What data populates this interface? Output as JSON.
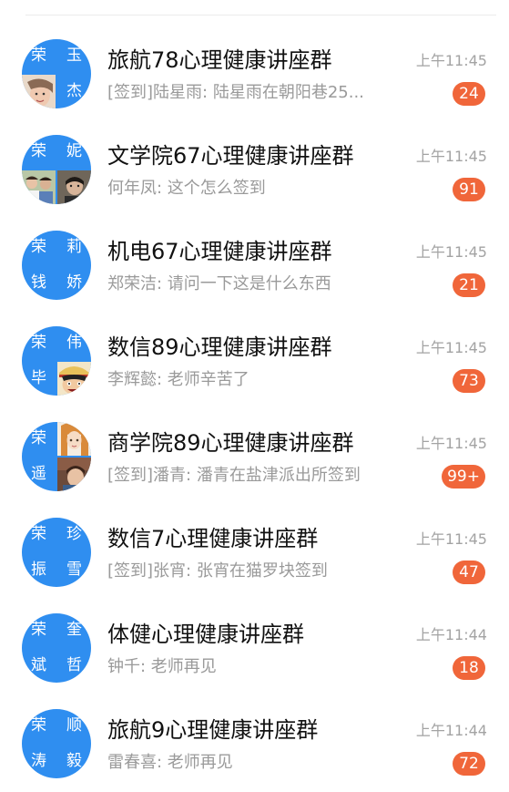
{
  "colors": {
    "avatar_blue": "#2f8ef0",
    "badge_orange": "#f0663a"
  },
  "conversations": [
    {
      "title": "旅航78心理健康讲座群",
      "preview": "[签到]陆星雨: 陆星雨在朝阳巷25...",
      "time": "上午11:45",
      "badge": "24",
      "avatar": [
        {
          "type": "text",
          "text": "荣"
        },
        {
          "type": "text",
          "text": "玉"
        },
        {
          "type": "photo",
          "name": "woman-face-photo"
        },
        {
          "type": "text",
          "text": "杰"
        }
      ]
    },
    {
      "title": "文学院67心理健康讲座群",
      "preview": "何年凤: 这个怎么签到",
      "time": "上午11:45",
      "badge": "91",
      "avatar": [
        {
          "type": "text",
          "text": "荣"
        },
        {
          "type": "text",
          "text": "妮"
        },
        {
          "type": "photo",
          "name": "group-photo"
        },
        {
          "type": "photo",
          "name": "portrait-photo"
        }
      ]
    },
    {
      "title": "机电67心理健康讲座群",
      "preview": "郑荣洁: 请问一下这是什么东西",
      "time": "上午11:45",
      "badge": "21",
      "avatar": [
        {
          "type": "text",
          "text": "荣"
        },
        {
          "type": "text",
          "text": "莉"
        },
        {
          "type": "text",
          "text": "钱"
        },
        {
          "type": "text",
          "text": "娇"
        }
      ]
    },
    {
      "title": "数信89心理健康讲座群",
      "preview": "李辉懿: 老师辛苦了",
      "time": "上午11:45",
      "badge": "73",
      "avatar": [
        {
          "type": "text",
          "text": "荣"
        },
        {
          "type": "text",
          "text": "伟"
        },
        {
          "type": "text",
          "text": "毕"
        },
        {
          "type": "photo",
          "name": "cartoon-character-photo"
        }
      ]
    },
    {
      "title": "商学院89心理健康讲座群",
      "preview": "[签到]潘青: 潘青在盐津派出所签到",
      "time": "上午11:45",
      "badge": "99+",
      "avatar": [
        {
          "type": "text",
          "text": "荣"
        },
        {
          "type": "photo",
          "name": "anime-girl-photo"
        },
        {
          "type": "text",
          "text": "遥"
        },
        {
          "type": "photo",
          "name": "anime-scene-photo"
        }
      ]
    },
    {
      "title": "数信7心理健康讲座群",
      "preview": "[签到]张宵: 张宵在猫罗块签到",
      "time": "上午11:45",
      "badge": "47",
      "avatar": [
        {
          "type": "text",
          "text": "荣"
        },
        {
          "type": "text",
          "text": "珍"
        },
        {
          "type": "text",
          "text": "振"
        },
        {
          "type": "text",
          "text": "雪"
        }
      ]
    },
    {
      "title": "体健心理健康讲座群",
      "preview": "钟千: 老师再见",
      "time": "上午11:44",
      "badge": "18",
      "avatar": [
        {
          "type": "text",
          "text": "荣"
        },
        {
          "type": "text",
          "text": "奎"
        },
        {
          "type": "text",
          "text": "斌"
        },
        {
          "type": "text",
          "text": "哲"
        }
      ]
    },
    {
      "title": "旅航9心理健康讲座群",
      "preview": "雷春喜: 老师再见",
      "time": "上午11:44",
      "badge": "72",
      "avatar": [
        {
          "type": "text",
          "text": "荣"
        },
        {
          "type": "text",
          "text": "顺"
        },
        {
          "type": "text",
          "text": "涛"
        },
        {
          "type": "text",
          "text": "毅"
        }
      ]
    }
  ]
}
